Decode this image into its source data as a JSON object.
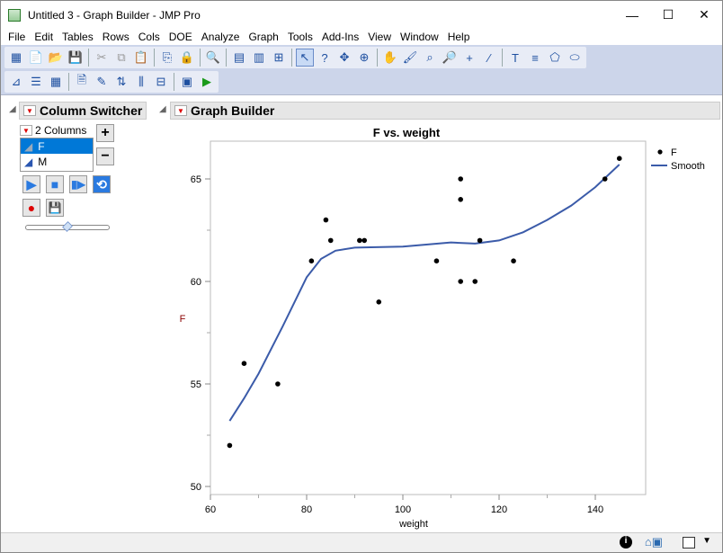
{
  "window": {
    "title": "Untitled 3 - Graph Builder - JMP Pro",
    "minimize": "—",
    "maximize": "☐",
    "close": "✕"
  },
  "menu": [
    "File",
    "Edit",
    "Tables",
    "Rows",
    "Cols",
    "DOE",
    "Analyze",
    "Graph",
    "Tools",
    "Add-Ins",
    "View",
    "Window",
    "Help"
  ],
  "column_switcher": {
    "title": "Column Switcher",
    "count_label": "2 Columns",
    "columns": [
      "F",
      "M"
    ],
    "selected": "F",
    "add": "+",
    "remove": "−",
    "slider_position": 0.5
  },
  "graph_builder": {
    "title": "Graph Builder"
  },
  "chart_data": {
    "type": "scatter",
    "title": "F vs. weight",
    "xlabel": "weight",
    "ylabel": "F",
    "xlim": [
      60,
      150
    ],
    "ylim": [
      49.5,
      67
    ],
    "xticks": [
      60,
      80,
      100,
      120,
      140
    ],
    "yticks": [
      50,
      55,
      60,
      65
    ],
    "points": [
      [
        64,
        52
      ],
      [
        67,
        56
      ],
      [
        74,
        55
      ],
      [
        81,
        61
      ],
      [
        84,
        63
      ],
      [
        85,
        62
      ],
      [
        91,
        62
      ],
      [
        92,
        62
      ],
      [
        95,
        59
      ],
      [
        107,
        61
      ],
      [
        112,
        65
      ],
      [
        112,
        64
      ],
      [
        112,
        60
      ],
      [
        115,
        60
      ],
      [
        116,
        62
      ],
      [
        123,
        61
      ],
      [
        142,
        65
      ],
      [
        145,
        66
      ]
    ],
    "smooth": [
      [
        64,
        53.2
      ],
      [
        67,
        54.3
      ],
      [
        70,
        55.5
      ],
      [
        75,
        57.8
      ],
      [
        80,
        60.2
      ],
      [
        83,
        61.1
      ],
      [
        86,
        61.5
      ],
      [
        90,
        61.65
      ],
      [
        100,
        61.7
      ],
      [
        110,
        61.9
      ],
      [
        115,
        61.85
      ],
      [
        120,
        62
      ],
      [
        125,
        62.4
      ],
      [
        130,
        63
      ],
      [
        135,
        63.7
      ],
      [
        140,
        64.6
      ],
      [
        145,
        65.7
      ]
    ],
    "legend": [
      {
        "label": "F",
        "type": "marker",
        "color": "#000000"
      },
      {
        "label": "Smooth",
        "type": "line",
        "color": "#3b5ba9"
      }
    ],
    "legend_position": "right"
  },
  "colors": {
    "smooth": "#3b5ba9",
    "selection": "#0078d7",
    "ylabel": "#8b0000"
  }
}
